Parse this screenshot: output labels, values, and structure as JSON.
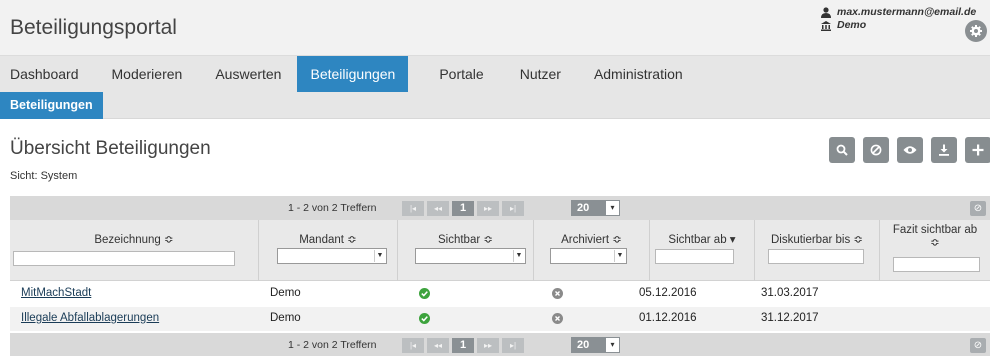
{
  "app": {
    "title": "Beteiligungsportal"
  },
  "user": {
    "email": "max.mustermann@email.de",
    "org": "Demo",
    "icon": "user-icon",
    "org_icon": "institution-icon"
  },
  "settings": {
    "icon": "gear-icon"
  },
  "nav": {
    "items": [
      {
        "label": "Dashboard",
        "active": false
      },
      {
        "label": "Moderieren",
        "active": false
      },
      {
        "label": "Auswerten",
        "active": false
      },
      {
        "label": "Beteiligungen",
        "active": true
      },
      {
        "label": "Portale",
        "active": false
      },
      {
        "label": "Nutzer",
        "active": false
      },
      {
        "label": "Administration",
        "active": false
      }
    ],
    "sub": {
      "label": "Beteiligungen"
    }
  },
  "page": {
    "title": "Übersicht Beteiligungen",
    "view": "Sicht: System"
  },
  "toolbar": {
    "icons": [
      "search-icon",
      "reset-filter-icon",
      "view-icon",
      "download-icon",
      "add-icon"
    ]
  },
  "pager": {
    "info": "1 - 2 von 2 Treffern",
    "first": "|◂",
    "prev": "◂◂",
    "current": "1",
    "next": "▸▸",
    "last": "▸|",
    "page_size": "20",
    "page_size_arrow": "▾"
  },
  "table": {
    "columns": [
      {
        "label": "Bezeichnung ≎",
        "filter": "text"
      },
      {
        "label": "Mandant ≎",
        "filter": "select"
      },
      {
        "label": "Sichtbar ≎",
        "filter": "select"
      },
      {
        "label": "Archiviert ≎",
        "filter": "select"
      },
      {
        "label": "Sichtbar ab ▾",
        "filter": "text"
      },
      {
        "label": "Diskutierbar bis ≎",
        "filter": "text"
      },
      {
        "label": "Fazit sichtbar ab ≎",
        "filter": "text"
      }
    ],
    "rows": [
      {
        "name": "MitMachStadt",
        "mandant": "Demo",
        "sichtbar": true,
        "archiviert": false,
        "sichtbar_ab": "05.12.2016",
        "diskutierbar_bis": "31.03.2017",
        "fazit": ""
      },
      {
        "name": "Illegale Abfallablagerungen",
        "mandant": "Demo",
        "sichtbar": true,
        "archiviert": false,
        "sichtbar_ab": "01.12.2016",
        "diskutierbar_bis": "31.12.2017",
        "fazit": ""
      }
    ]
  },
  "colors": {
    "accent": "#2e86c1",
    "button": "#878d90",
    "ok": "#3da33d",
    "neutral": "#8a8a8a"
  }
}
